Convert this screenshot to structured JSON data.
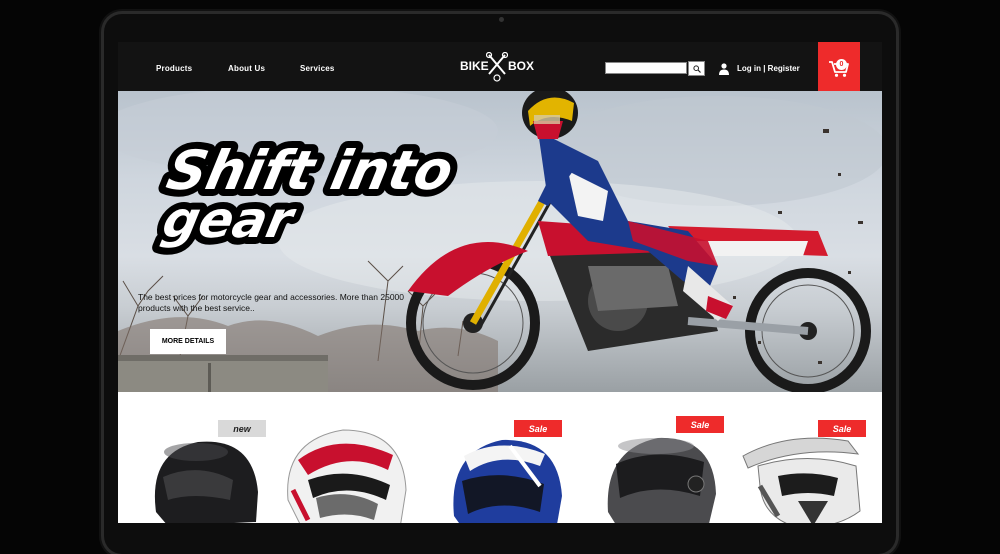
{
  "nav": {
    "links": [
      "Products",
      "About Us",
      "Services"
    ],
    "logo_left": "BIKE",
    "logo_right": "BOX",
    "search_placeholder": "",
    "login_label": "Log in | Register",
    "cart_count": "0"
  },
  "hero": {
    "title_line1": "Shift into",
    "title_line2": "gear",
    "subtitle": "The best prices for motorcycle gear and accessories. More than 25000 products with the best service..",
    "button_label": "MORE DETAILS"
  },
  "products": [
    {
      "name": "black-full-face-helmet",
      "badge": "new",
      "badge_style": "gray"
    },
    {
      "name": "arai-race-helmet",
      "badge": "",
      "badge_style": ""
    },
    {
      "name": "blue-racing-helmet",
      "badge": "Sale",
      "badge_style": "red"
    },
    {
      "name": "modular-helmet",
      "badge": "Sale",
      "badge_style": "red"
    },
    {
      "name": "motocross-helmet",
      "badge": "Sale",
      "badge_style": "red"
    }
  ],
  "colors": {
    "accent": "#ee2b2b",
    "nav_bg": "#131313",
    "badge_gray": "#d9d9d9"
  },
  "icons": [
    "search-icon",
    "user-icon",
    "cart-icon",
    "crossed-wrenches-icon"
  ]
}
